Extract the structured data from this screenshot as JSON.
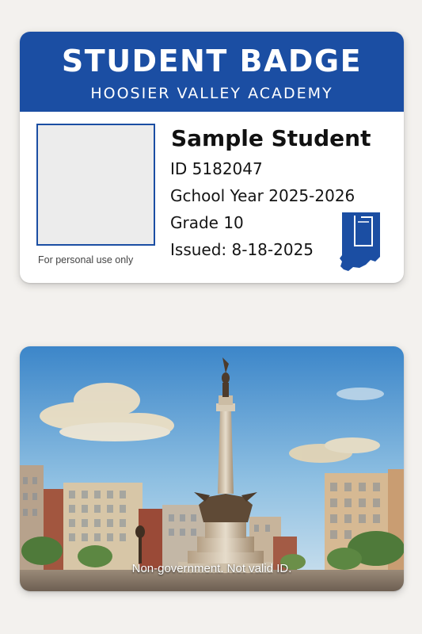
{
  "front": {
    "title": "STUDENT BADGE",
    "school": "HOOSIER VALLEY ACADEMY",
    "name": "Sample Student",
    "id_line": "ID  5182047",
    "school_year": "Gchool Year 2025-2026",
    "grade": "Grade 10",
    "issued": "Issued: 8-18-2025",
    "photo_note": "For personal use only",
    "state_icon": "indiana-state-silhouette-icon"
  },
  "back": {
    "disclaimer": "Non-government.  Not valid ID.",
    "scene": "painted-city-monument"
  },
  "colors": {
    "brand_blue": "#1b4ea3",
    "page_background": "#f3f1ee"
  }
}
